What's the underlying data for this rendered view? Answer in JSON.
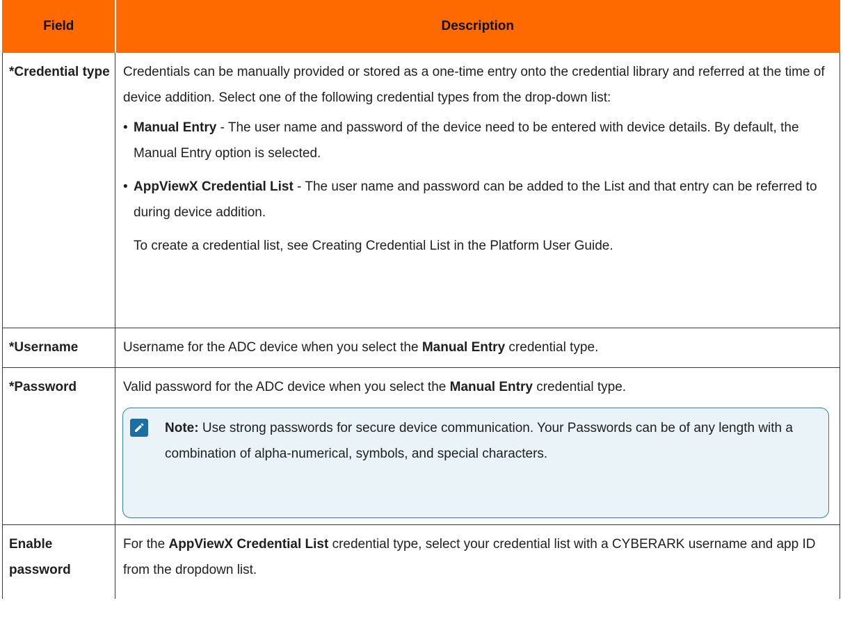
{
  "header": {
    "field": "Field",
    "description": "Description"
  },
  "rows": {
    "credential_type": {
      "field": "*Credential type",
      "intro": "Credentials can be manually provided or stored as a one-time entry onto the credential library and referred at the time of device addition. Select one of the following credential types from the drop-down list:",
      "bullets": [
        {
          "bullet": "•",
          "term": "Manual Entry",
          "text": " - The user name and password of the device need to be entered with device details. By default, the Manual Entry option is selected."
        },
        {
          "bullet": "•",
          "term": "AppViewX Credential List",
          "text": " - The user name and password can be added to the List and that entry can be referred to during device addition."
        }
      ],
      "followup": "To create a credential list, see Creating Credential List in the Platform User Guide."
    },
    "username": {
      "field": "*Username",
      "text_before": "Username for the ADC device when you select the ",
      "term": "Manual Entry",
      "text_after": " credential type."
    },
    "password": {
      "field": "*Password",
      "text_before": "Valid password for the ADC device when you select the ",
      "term": "Manual Entry",
      "text_after": " credential type.",
      "note": {
        "icon": "note-pencil-icon",
        "label": "Note:",
        "text": " Use strong passwords for secure device communication. Your Passwords can be of any length with a combination of alpha-numerical, symbols, and special characters."
      }
    },
    "enable_password": {
      "field": "Enable password",
      "text_before": "For the ",
      "term": "AppViewX Credential List",
      "text_after": " credential type, select your credential list with a CYBERARK username and app ID from the dropdown list."
    }
  },
  "colors": {
    "header_bg": "#ff6a00",
    "note_bg": "#e9f3f8",
    "note_border": "#2d7fb0",
    "note_icon_bg": "#1c6fa3"
  }
}
